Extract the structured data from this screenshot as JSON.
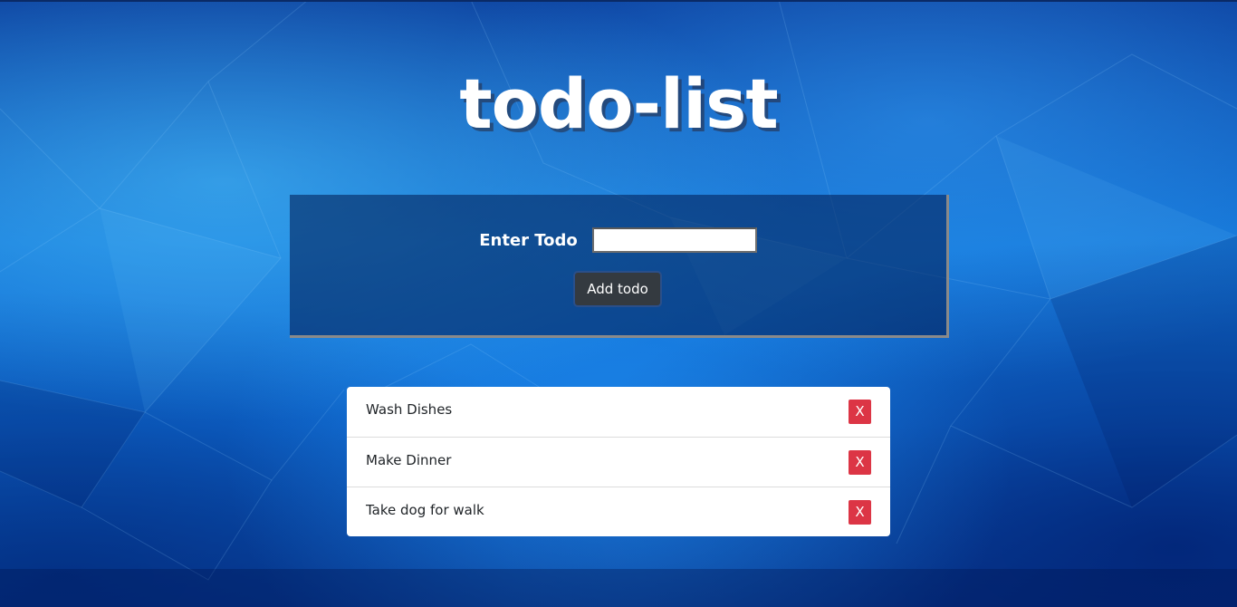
{
  "page": {
    "title": "todo-list"
  },
  "form": {
    "label": "Enter Todo",
    "input_value": "",
    "input_placeholder": "",
    "add_button_label": "Add todo"
  },
  "todos": [
    {
      "text": "Wash Dishes",
      "delete_label": "X"
    },
    {
      "text": "Make Dinner",
      "delete_label": "X"
    },
    {
      "text": "Take dog for walk",
      "delete_label": "X"
    }
  ],
  "colors": {
    "background": "#1476d8",
    "form_panel": "#00194f",
    "add_button": "#343a40",
    "delete_button": "#dc3545",
    "title_text": "#ffffff"
  },
  "icons": {
    "background": "low-poly-triangles-background"
  }
}
